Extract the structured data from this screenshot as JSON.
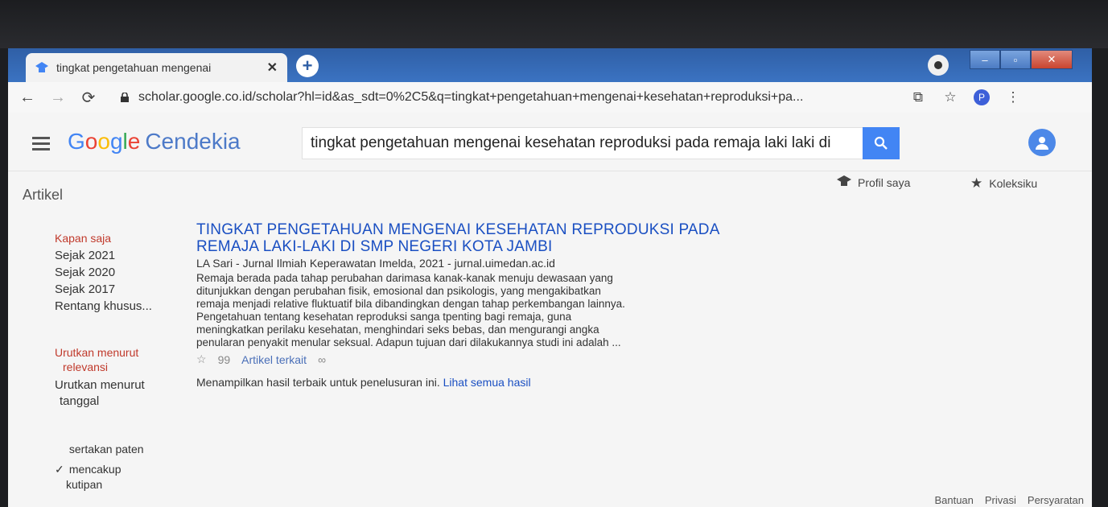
{
  "browser": {
    "tab_title": "tingkat pengetahuan mengenai",
    "tab_close": "✕",
    "new_tab": "+",
    "url": "scholar.google.co.id/scholar?hl=id&as_sdt=0%2C5&q=tingkat+pengetahuan+mengenai+kesehatan+reproduksi+pa...",
    "profile_initial": "P",
    "window_buttons": [
      "–",
      "▫",
      "✕"
    ]
  },
  "header": {
    "logo_letters": [
      "G",
      "o",
      "o",
      "g",
      "l",
      "e"
    ],
    "logo_suffix": "Cendekia",
    "search_value": "tingkat pengetahuan mengenai kesehatan reproduksi pada remaja laki laki di"
  },
  "section_label": "Artikel",
  "links": {
    "profile": "Profil saya",
    "library": "Koleksiku"
  },
  "sidebar": {
    "time_filters": [
      "Kapan saja",
      "Sejak 2021",
      "Sejak 2020",
      "Sejak 2017",
      "Rentang khusus..."
    ],
    "sort_relevance": [
      "Urutkan menurut",
      "relevansi"
    ],
    "sort_date": [
      "Urutkan menurut",
      "tanggal"
    ],
    "include_patents": "sertakan paten",
    "include_citations": [
      "mencakup",
      "kutipan"
    ]
  },
  "result": {
    "title_line1": "TINGKAT PENGETAHUAN MENGENAI KESEHATAN REPRODUKSI PADA",
    "title_line2": "REMAJA LAKI-LAKI DI SMP NEGERI KOTA JAMBI",
    "meta": "LA Sari - Jurnal Ilmiah Keperawatan Imelda, 2021 - jurnal.uimedan.ac.id",
    "snippet_lines": [
      "Remaja berada pada tahap perubahan darimasa kanak-kanak menuju dewasaan yang",
      "ditunjukkan dengan perubahan fisik, emosional dan psikologis, yang mengakibatkan",
      "remaja menjadi relative fluktuatif bila dibandingkan dengan tahap perkembangan lainnya.",
      "Pengetahuan tentang kesehatan reproduksi sanga tpenting bagi remaja, guna",
      "meningkatkan perilaku kesehatan, menghindari seks bebas, dan mengurangi angka",
      "penularan penyakit menular seksual. Adapun tujuan dari dilakukannya studi ini adalah ..."
    ],
    "save_glyph": "☆",
    "cite_glyph": "99",
    "related": "Artikel terkait",
    "versions_glyph": "∞"
  },
  "summary": {
    "text": "Menampilkan hasil terbaik untuk penelusuran ini.",
    "link": "Lihat semua hasil"
  },
  "footer": [
    "Bantuan",
    "Privasi",
    "Persyaratan"
  ]
}
